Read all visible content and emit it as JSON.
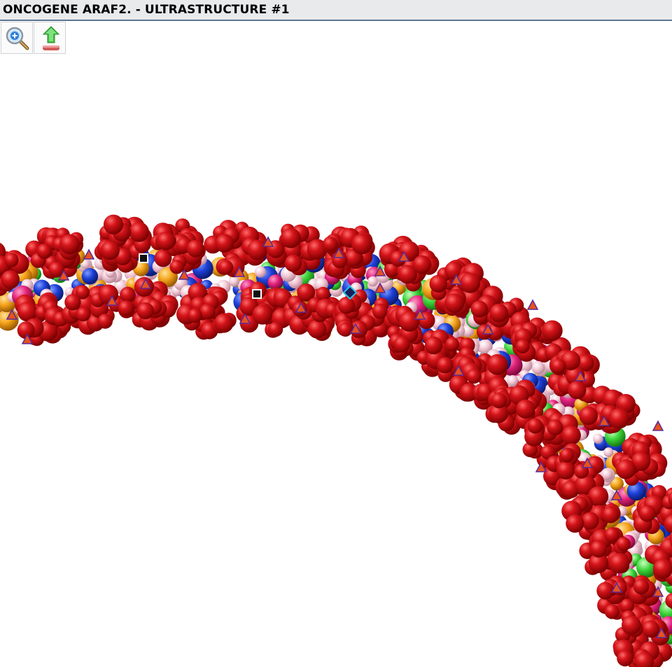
{
  "window": {
    "title": "ONCOGENE ARAF2. - ULTRASTRUCTURE #1"
  },
  "toolbar": {
    "buttons": [
      {
        "name": "zoom-in-button",
        "icon": "magnifier-plus-icon"
      },
      {
        "name": "export-button",
        "icon": "upload-arrow-icon"
      }
    ]
  },
  "colors": {
    "backbone": "#c00c12",
    "backbone_highlight": "#ff4a4a",
    "backbone_shadow": "#6e0000",
    "base_pink": "#f2c8d4",
    "base_blue": "#1d3fd6",
    "base_green": "#3ed43a",
    "base_orange": "#f5a21a",
    "base_magenta": "#e0207a",
    "titlebar_bg": "#e9eaec",
    "titlebar_border": "#5d7591",
    "marker_triangle_fill": "#e8511c",
    "marker_triangle_stroke": "#5a2a9a",
    "marker_square_fill": "#111111",
    "marker_diamond_stroke": "#24c6e8"
  },
  "markers": {
    "triangles": 30,
    "squares": 2,
    "diamonds": 1
  }
}
